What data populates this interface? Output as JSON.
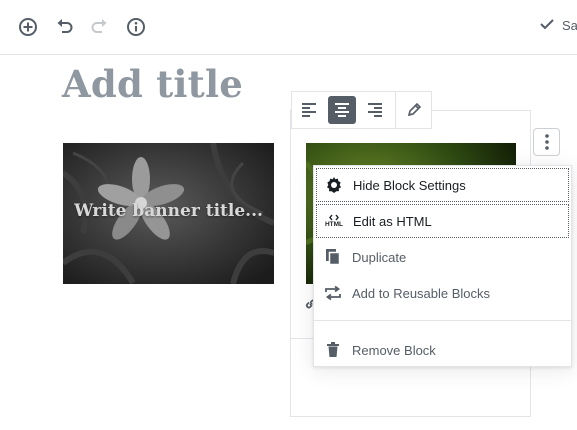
{
  "topbar": {
    "saved_label": "Saved",
    "icons": [
      "plus-circle-icon",
      "undo-icon",
      "redo-icon",
      "info-icon"
    ]
  },
  "editor": {
    "title_placeholder": "Add title"
  },
  "banner_block": {
    "title_placeholder": "Write banner title..."
  },
  "block_toolbar": {
    "buttons": [
      "align-left",
      "align-center",
      "align-right",
      "edit-pencil"
    ],
    "active": "align-center"
  },
  "block_menu": {
    "items": [
      {
        "label": "Hide Block Settings",
        "icon": "gear-icon"
      },
      {
        "label": "Edit as HTML",
        "icon": "html-icon",
        "icon_text": "HTML"
      },
      {
        "label": "Duplicate",
        "icon": "duplicate-icon"
      },
      {
        "label": "Add to Reusable Blocks",
        "icon": "reusable-icon"
      },
      {
        "label": "Remove Block",
        "icon": "trash-icon"
      }
    ]
  },
  "colors": {
    "accent_dark": "#555d66",
    "title_placeholder": "#8f98a1",
    "border": "#e2e4e7"
  }
}
